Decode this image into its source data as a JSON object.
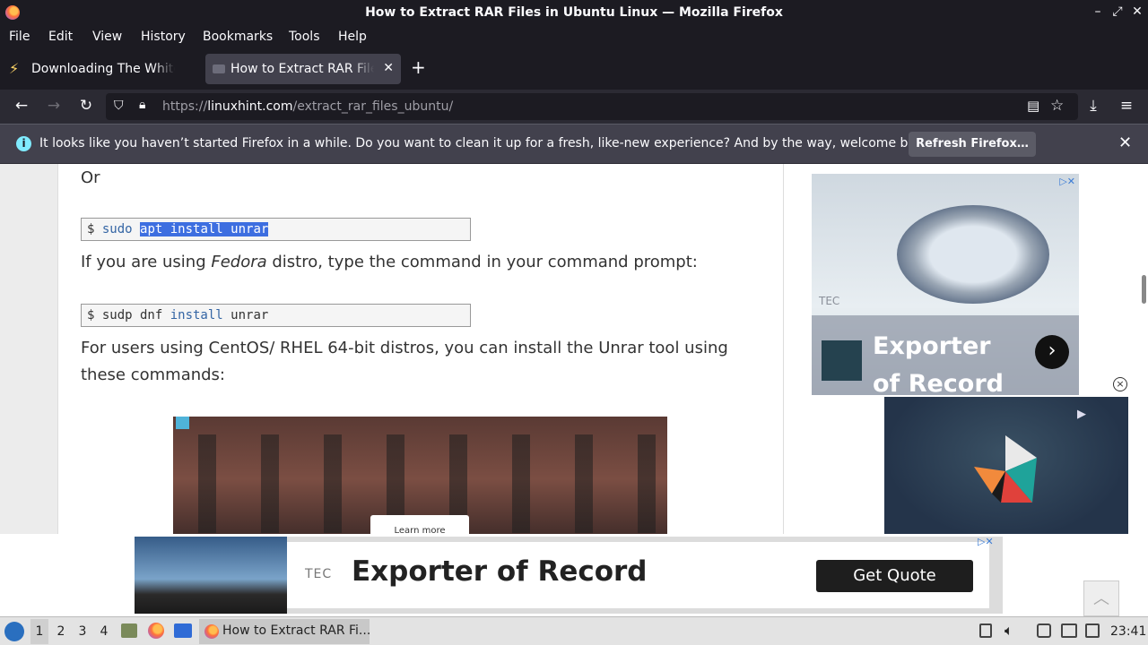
{
  "window": {
    "title": "How to Extract RAR Files in Ubuntu Linux — Mozilla Firefox",
    "controls": [
      "–",
      "⤢",
      "✕"
    ]
  },
  "menu": [
    "File",
    "Edit",
    "View",
    "History",
    "Bookmarks",
    "Tools",
    "Help"
  ],
  "tabs": [
    {
      "label": "Downloading The White Lotus",
      "icon": "lightning-icon",
      "active": false
    },
    {
      "label": "How to Extract RAR Files in Ubuntu",
      "icon": "linuxhint-favicon",
      "active": true
    }
  ],
  "nav": {
    "url_prefix": "https://",
    "url_domain": "linuxhint.com",
    "url_path": "/extract_rar_files_ubuntu/"
  },
  "notification": {
    "message": "It looks like you haven’t started Firefox in a while. Do you want to clean it up for a fresh, like-new experience? And by the way, welcome back!",
    "button": "Refresh Firefox…"
  },
  "article": {
    "or_text": "Or",
    "code1": {
      "prompt": "$ ",
      "cmd": "sudo ",
      "selected": "apt install unrar"
    },
    "fedora_pre": "If you are using ",
    "fedora_em": "Fedora",
    "fedora_post": " distro, type the command in your command prompt:",
    "code2": {
      "prompt": "$ ",
      "cmd": "sudp dnf ",
      "kw": "install",
      "rest": " unrar"
    },
    "centos_text": "For users using CentOS/ RHEL 64-bit distros, you can install the Unrar tool using these commands:",
    "video_caption": "Learn more"
  },
  "ads": {
    "side_headline": "Exporter of Record",
    "side_logo": "TEC",
    "bottom_logo": "TEC",
    "bottom_headline": "Exporter of Record",
    "bottom_cta": "Get Quote"
  },
  "taskbar": {
    "workspaces": [
      "1",
      "2",
      "3",
      "4"
    ],
    "active_workspace": "1",
    "task_label": "How to Extract RAR Fi...",
    "clock": "23:41"
  }
}
